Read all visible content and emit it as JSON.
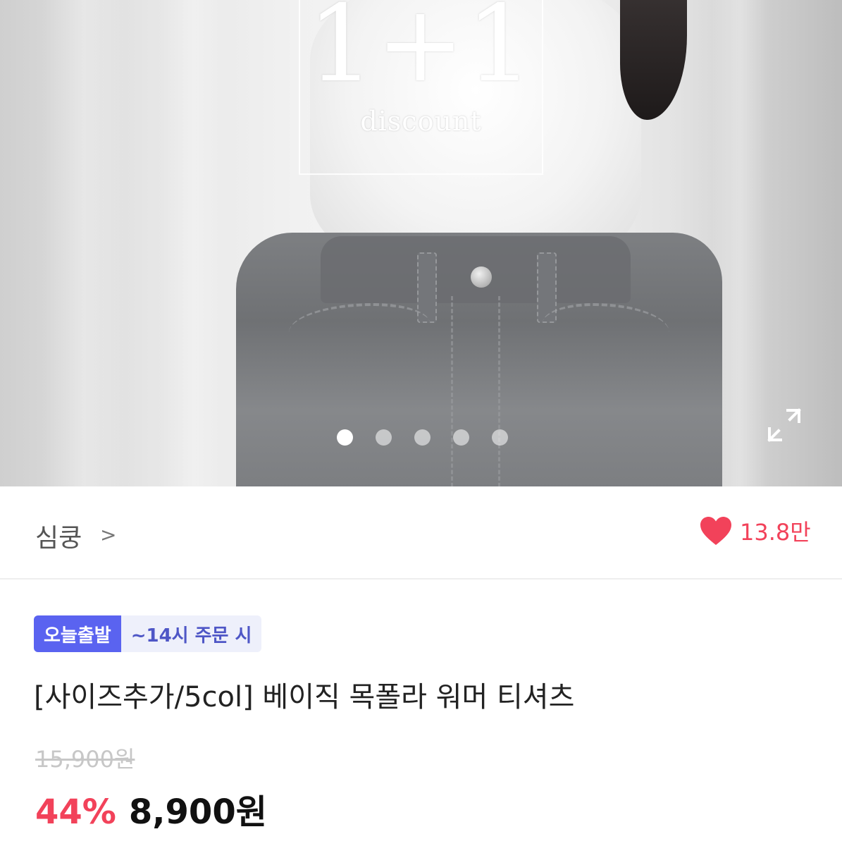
{
  "hero": {
    "promo_big": "1+1",
    "promo_small": "discount",
    "carousel": {
      "total": 5,
      "active_index": 0
    },
    "expand_icon": "expand-icon"
  },
  "shop": {
    "name": "심쿵",
    "chevron": ">",
    "like_icon": "heart-icon",
    "like_count": "13.8만"
  },
  "product": {
    "badge_today": "오늘출발",
    "badge_time": "~14시 주문 시",
    "title": "[사이즈추가/5col] 베이직 목폴라 워머 티셔츠",
    "original_price": "15,900원",
    "discount": "44%",
    "price": "8,900원"
  },
  "colors": {
    "accent_red": "#f2425a",
    "badge_blue": "#5a63f0",
    "badge_bg": "#eef0fb"
  }
}
